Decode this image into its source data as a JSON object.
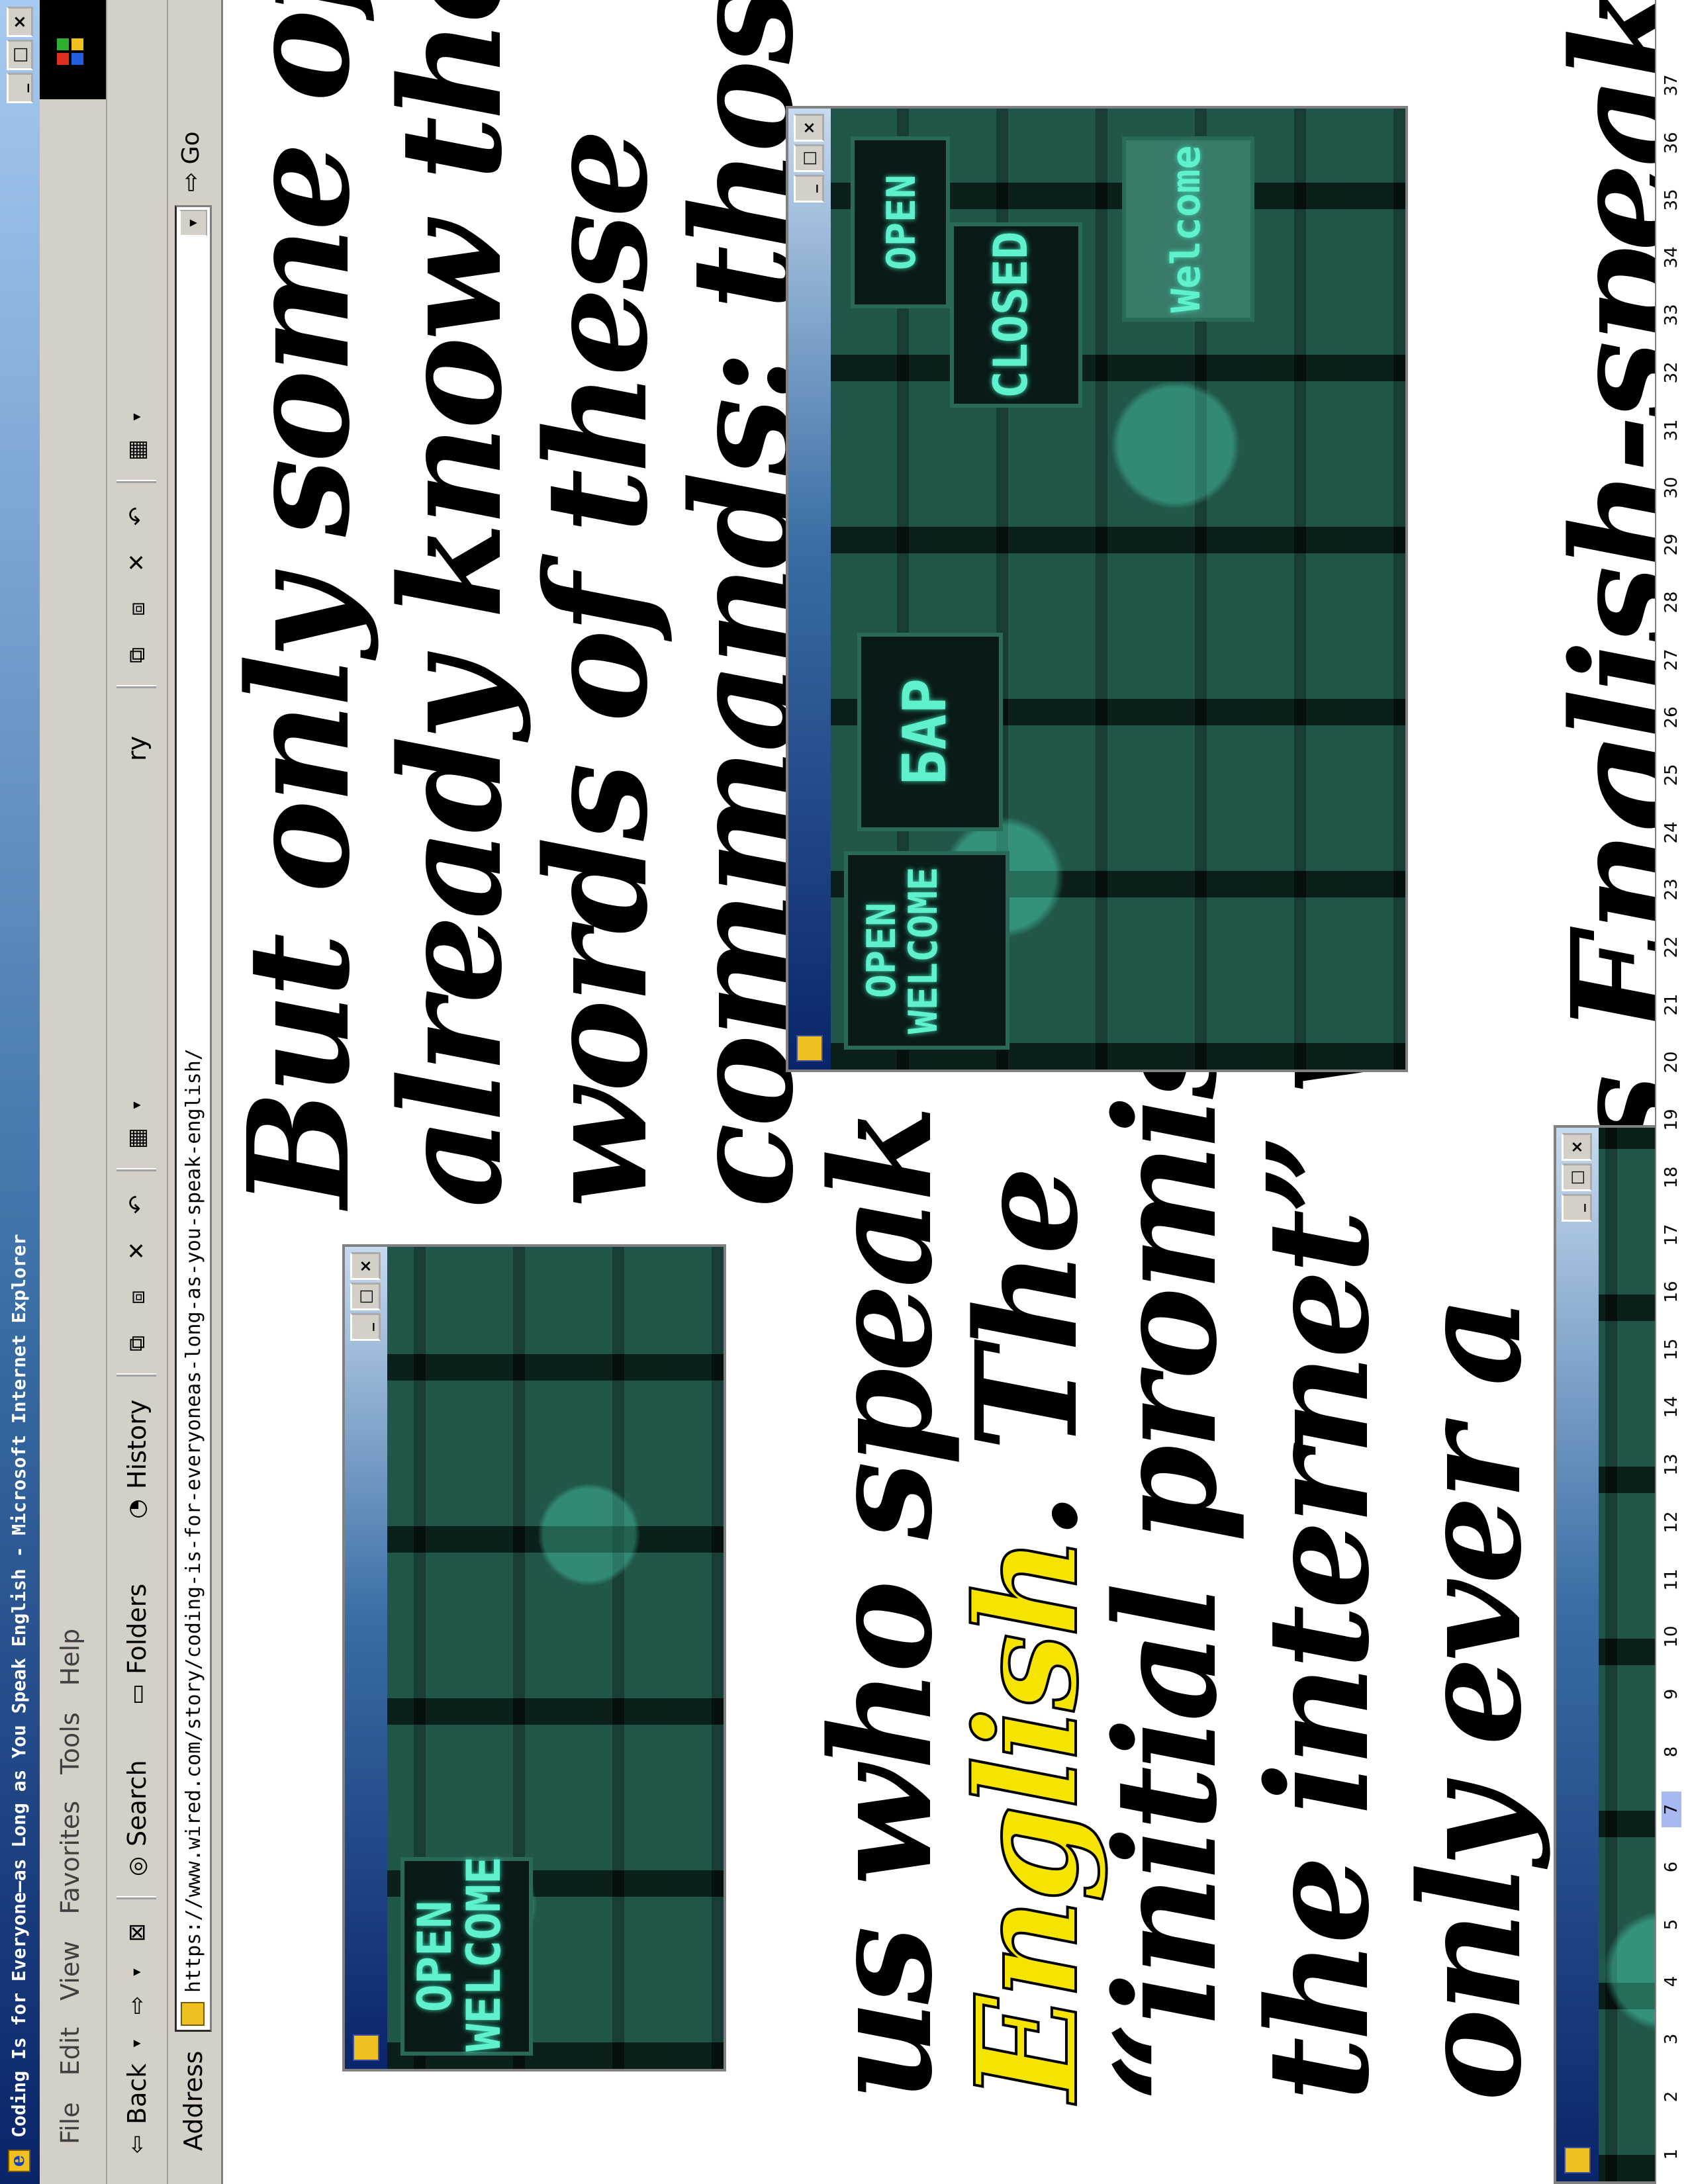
{
  "window": {
    "title": "Coding Is for Everyone—as Long as You Speak English - Microsoft Internet Explorer",
    "controls": {
      "minimize": "_",
      "maximize": "□",
      "close": "×"
    }
  },
  "menu": [
    "File",
    "Edit",
    "View",
    "Favorites",
    "Tools",
    "Help"
  ],
  "toolbar": {
    "back": "Back",
    "search": "Search",
    "folders": "Folders",
    "history": "History",
    "history_clipped": "ry"
  },
  "address": {
    "label": "Address",
    "url_main": "https://www.wired.com/story/coding-is-for-everyoneas-long-as-you-speak-english/",
    "url_popup": "https://www.wired.com/story/coding-is-for-everyoneas-long-as-you-speak-english/",
    "go": "Go"
  },
  "line_numbers": [
    "1",
    "2",
    "3",
    "4",
    "5",
    "6",
    "7",
    "8",
    "9",
    "10",
    "11",
    "12",
    "13",
    "14",
    "15",
    "16",
    "17",
    "18",
    "19",
    "20",
    "21",
    "22",
    "23",
    "24",
    "25",
    "26",
    "27",
    "28",
    "29",
    "30",
    "31",
    "32",
    "33",
    "34",
    "35",
    "36",
    "37"
  ],
  "highlighted_line": "7",
  "article": {
    "lines_top": [
      "But only some of us",
      "already know the",
      "words of these",
      "commands: those of"
    ],
    "lines_bottom": [
      "us who speak",
      "English",
      ". The",
      "“initial promise of",
      "the internet” was",
      "only ever a",
      "promise to its English-speaking"
    ],
    "highlight_color": "#f5e400"
  },
  "popups": {
    "left_signs": [
      "OPEN",
      "WELCOME"
    ],
    "right_signs": [
      "OPEN",
      "WELCOME",
      "CLOSED",
      "OPEN",
      "Welcome",
      "БАР"
    ]
  }
}
